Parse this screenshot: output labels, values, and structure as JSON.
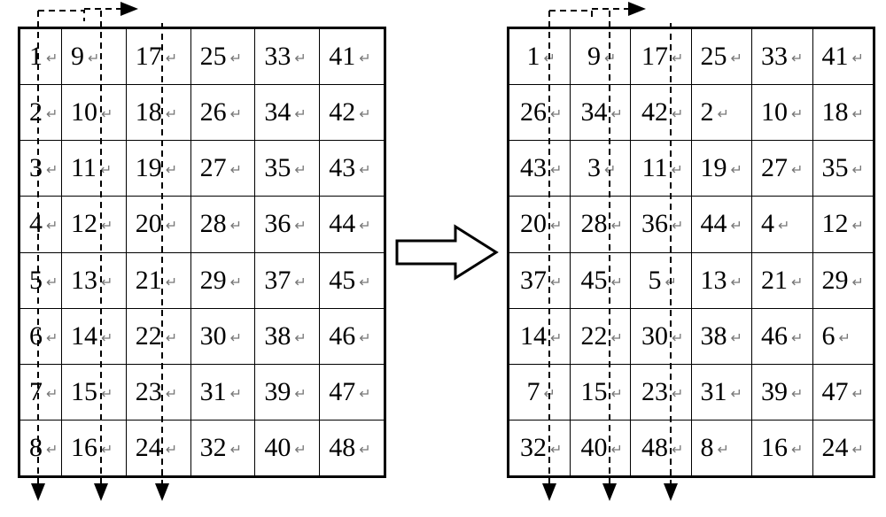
{
  "left_table": [
    [
      "1",
      "9",
      "17",
      "25",
      "33",
      "41"
    ],
    [
      "2",
      "10",
      "18",
      "26",
      "34",
      "42"
    ],
    [
      "3",
      "11",
      "19",
      "27",
      "35",
      "43"
    ],
    [
      "4",
      "12",
      "20",
      "28",
      "36",
      "44"
    ],
    [
      "5",
      "13",
      "21",
      "29",
      "37",
      "45"
    ],
    [
      "6",
      "14",
      "22",
      "30",
      "38",
      "46"
    ],
    [
      "7",
      "15",
      "23",
      "31",
      "39",
      "47"
    ],
    [
      "8",
      "16",
      "24",
      "32",
      "40",
      "48"
    ]
  ],
  "right_table": [
    [
      "1",
      "9",
      "17",
      "25",
      "33",
      "41"
    ],
    [
      "26",
      "34",
      "42",
      "2",
      "10",
      "18"
    ],
    [
      "43",
      "3",
      "11",
      "19",
      "27",
      "35"
    ],
    [
      "20",
      "28",
      "36",
      "44",
      "4",
      "12"
    ],
    [
      "37",
      "45",
      "5",
      "13",
      "21",
      "29"
    ],
    [
      "14",
      "22",
      "30",
      "38",
      "46",
      "6"
    ],
    [
      "7",
      "15",
      "23",
      "31",
      "39",
      "47"
    ],
    [
      "32",
      "40",
      "48",
      "8",
      "16",
      "24"
    ]
  ],
  "cell_mark": "↵"
}
